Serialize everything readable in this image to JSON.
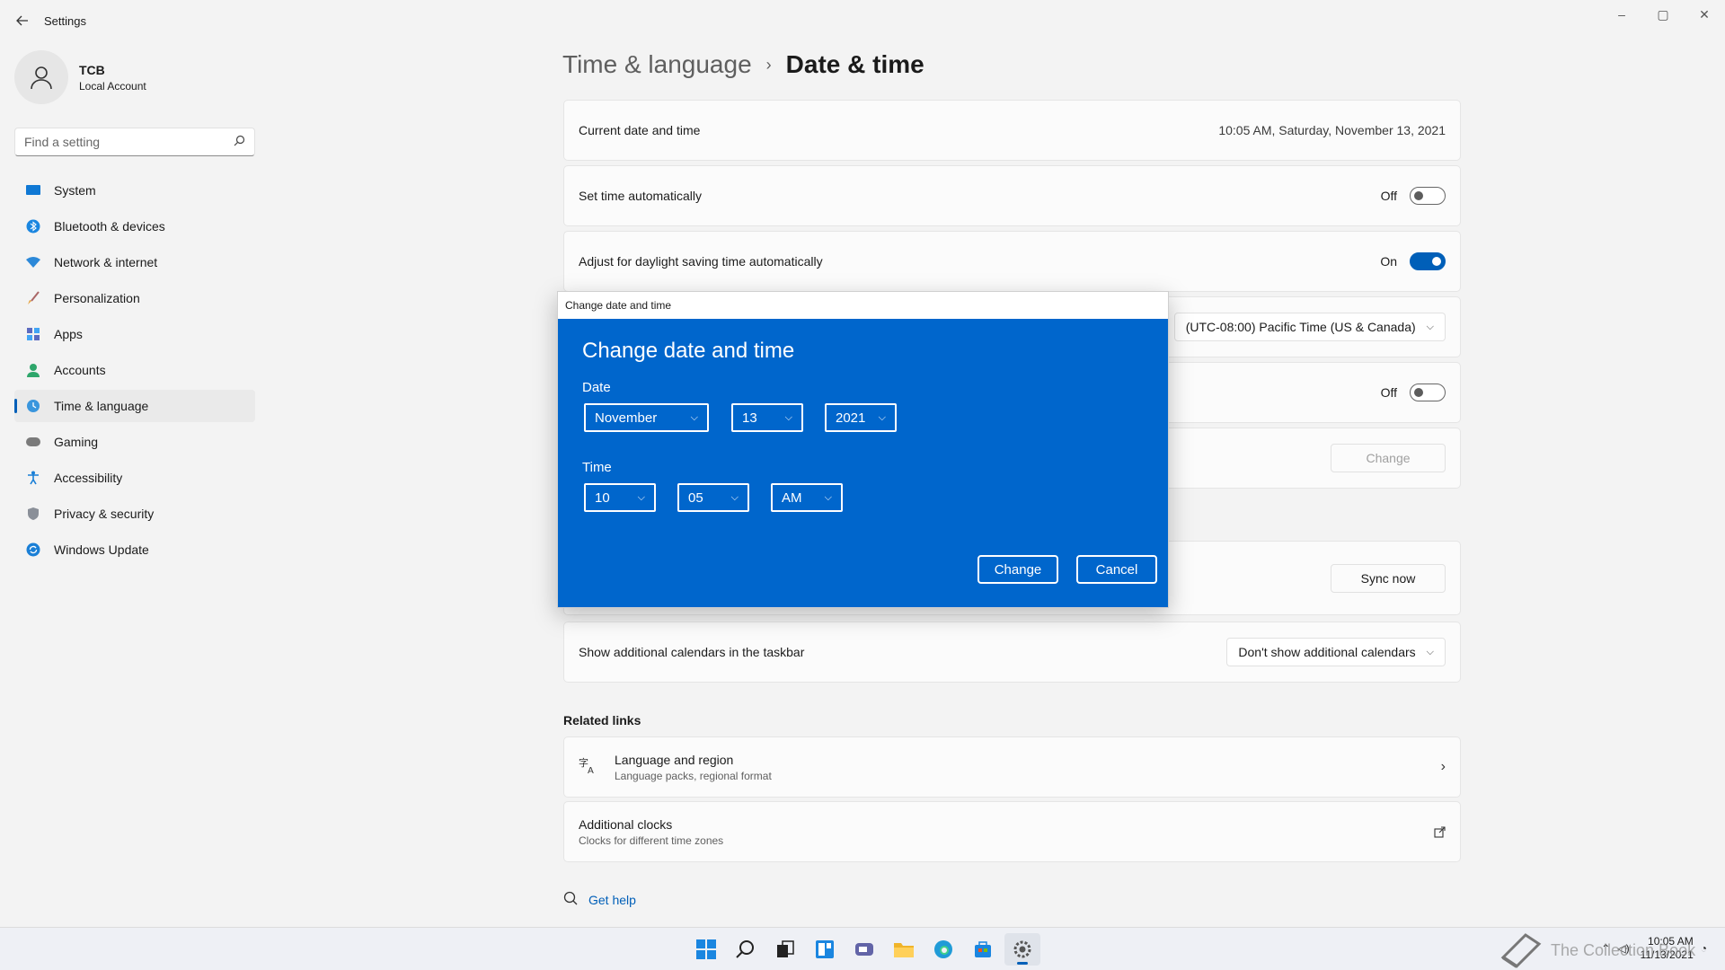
{
  "app": {
    "title": "Settings"
  },
  "window_controls": {
    "minimize": "–",
    "maximize": "▢",
    "close": "✕"
  },
  "profile": {
    "name": "TCB",
    "account_type": "Local Account"
  },
  "search": {
    "placeholder": "Find a setting"
  },
  "sidebar": {
    "items": [
      {
        "label": "System",
        "icon": "system-icon"
      },
      {
        "label": "Bluetooth & devices",
        "icon": "bluetooth-icon"
      },
      {
        "label": "Network & internet",
        "icon": "wifi-icon"
      },
      {
        "label": "Personalization",
        "icon": "brush-icon"
      },
      {
        "label": "Apps",
        "icon": "apps-icon"
      },
      {
        "label": "Accounts",
        "icon": "person-icon"
      },
      {
        "label": "Time & language",
        "icon": "globe-clock-icon",
        "active": true
      },
      {
        "label": "Gaming",
        "icon": "gamepad-icon"
      },
      {
        "label": "Accessibility",
        "icon": "accessibility-icon"
      },
      {
        "label": "Privacy & security",
        "icon": "shield-icon"
      },
      {
        "label": "Windows Update",
        "icon": "update-icon"
      }
    ]
  },
  "breadcrumb": {
    "parent": "Time & language",
    "separator": "›",
    "current": "Date & time"
  },
  "settings": {
    "current": {
      "label": "Current date and time",
      "value": "10:05 AM, Saturday, November 13, 2021"
    },
    "set_time_auto": {
      "label": "Set time automatically",
      "state": "Off"
    },
    "dst": {
      "label": "Adjust for daylight saving time automatically",
      "state": "On"
    },
    "timezone": {
      "value": "(UTC-08:00) Pacific Time (US & Canada)"
    },
    "tz_auto": {
      "state": "Off"
    },
    "manual": {
      "button": "Change"
    },
    "sync": {
      "button": "Sync now"
    },
    "calendars": {
      "label": "Show additional calendars in the taskbar",
      "value": "Don't show additional calendars"
    }
  },
  "related": {
    "heading": "Related links",
    "language": {
      "title": "Language and region",
      "subtitle": "Language packs, regional format"
    },
    "clocks": {
      "title": "Additional clocks",
      "subtitle": "Clocks for different time zones"
    }
  },
  "help": {
    "label": "Get help"
  },
  "dialog": {
    "window_title": "Change date and time",
    "heading": "Change date and time",
    "date_label": "Date",
    "month": "November",
    "day": "13",
    "year": "2021",
    "time_label": "Time",
    "hour": "10",
    "minute": "05",
    "ampm": "AM",
    "change_button": "Change",
    "cancel_button": "Cancel"
  },
  "taskbar": {
    "time": "10:05 AM",
    "date": "11/13/2021"
  },
  "watermark": {
    "text": "The Collection Book"
  },
  "colors": {
    "accent": "#005fb8",
    "dialog": "#0066cc"
  }
}
